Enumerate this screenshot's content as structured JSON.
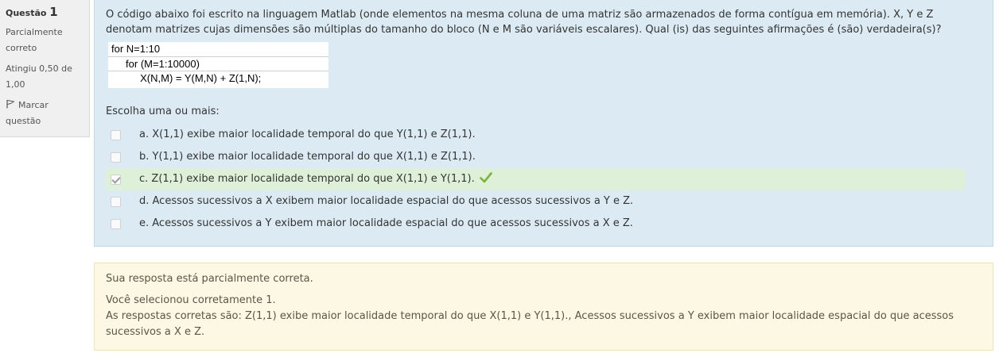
{
  "info": {
    "question_label": "Questão",
    "question_number": "1",
    "state": "Parcialmente correto",
    "grade": "Atingiu 0,50 de 1,00",
    "flag_label": "Marcar questão"
  },
  "question": {
    "text": "O código abaixo foi escrito na linguagem Matlab (onde elementos na mesma coluna de uma matriz são armazenados de forma contígua em memória). X, Y e Z denotam matrizes cujas dimensões são múltiplas do tamanho do bloco (N e M são variáveis escalares). Qual (is) das seguintes afirmações é (são) verdadeira(s)?",
    "code_lines": [
      "for N=1:10",
      "     for (M=1:10000)",
      "          X(N,M) = Y(M,N) + Z(1,N);"
    ],
    "prompt": "Escolha uma ou mais:",
    "answers": [
      {
        "label": "a. X(1,1) exibe maior localidade temporal do que Y(1,1) e Z(1,1).",
        "checked": false,
        "correct": false
      },
      {
        "label": "b. Y(1,1) exibe maior localidade temporal do que X(1,1) e Z(1,1).",
        "checked": false,
        "correct": false
      },
      {
        "label": "c. Z(1,1) exibe maior localidade temporal do que X(1,1) e Y(1,1).",
        "checked": true,
        "correct": true
      },
      {
        "label": "d. Acessos sucessivos a X exibem maior localidade espacial do que acessos sucessivos a Y e Z.",
        "checked": false,
        "correct": false
      },
      {
        "label": "e. Acessos sucessivos a Y exibem maior localidade espacial do que acessos sucessivos a X e Z.",
        "checked": false,
        "correct": false
      }
    ]
  },
  "feedback": {
    "general": "Sua resposta está parcialmente correta.",
    "num_correct": "Você selecionou corretamente 1.",
    "right_answer": "As respostas corretas são: Z(1,1) exibe maior localidade temporal do que X(1,1) e Y(1,1)., Acessos sucessivos a Y exibem maior localidade espacial do que acessos sucessivos a X e Z."
  },
  "colors": {
    "info_bg": "#f0f0f0",
    "question_bg": "#dcebf3",
    "correct_bg": "#dff0d8",
    "tick": "#7ab33b",
    "feedback_bg": "#fcf8e3"
  },
  "icons": {
    "flag": "flag-icon",
    "correct": "check-icon"
  }
}
